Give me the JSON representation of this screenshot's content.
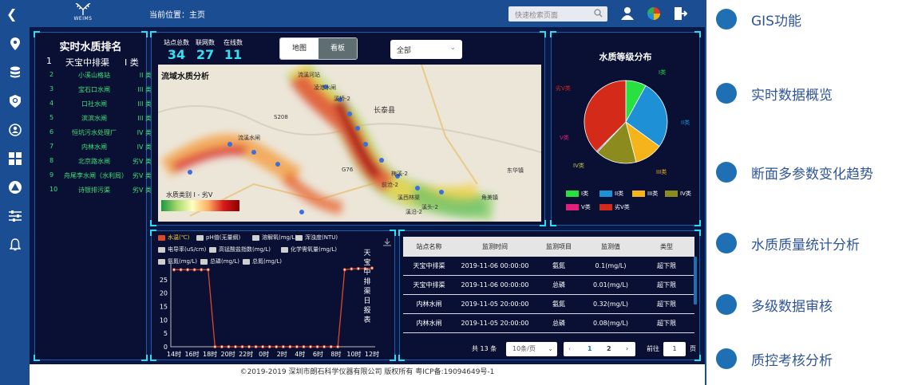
{
  "header": {
    "breadcrumb": "当前位置：主页",
    "logo_text": "WEIMS",
    "search_placeholder": "快速检索页面"
  },
  "ranking": {
    "title": "实时水质排名",
    "top": {
      "rank": "1",
      "name": "天宝中排渠",
      "class": "I 类"
    },
    "rows": [
      {
        "rank": "2",
        "name": "小溪山格站",
        "class": "II 类"
      },
      {
        "rank": "3",
        "name": "宝石口水闸",
        "class": "III 类"
      },
      {
        "rank": "4",
        "name": "口社水闸",
        "class": "III 类"
      },
      {
        "rank": "5",
        "name": "滨滨水闸",
        "class": "III 类"
      },
      {
        "rank": "6",
        "name": "恒坑污水处理厂",
        "class": "IV 类"
      },
      {
        "rank": "7",
        "name": "内林水闸",
        "class": "IV 类"
      },
      {
        "rank": "8",
        "name": "北京路水闸",
        "class": "劣V 类"
      },
      {
        "rank": "9",
        "name": "舟尾李水闸（水利局）",
        "class": "劣V 类"
      },
      {
        "rank": "10",
        "name": "诗银排污渠",
        "class": "劣V 类"
      }
    ]
  },
  "overview": {
    "stats": [
      {
        "label": "站点总数",
        "value": "34"
      },
      {
        "label": "联网数",
        "value": "27"
      },
      {
        "label": "在线数",
        "value": "11"
      }
    ],
    "tabs": [
      "地图",
      "看板"
    ],
    "filter_value": "全部",
    "map_title": "流域水质分析",
    "legend_label": "水质类别 I - 劣V",
    "map_labels": [
      "流溪河站",
      "凌港水闸",
      "溪桥-2",
      "长泰县",
      "S208",
      "流溪水闸",
      "东华镇",
      "G76",
      "梅溪-2",
      "前沧-2",
      "溪西林渠",
      "角美镇",
      "溪沿-2",
      "溪头-2"
    ]
  },
  "pie": {
    "title": "水质等级分布",
    "legend": [
      {
        "name": "I类",
        "color": "#28e040"
      },
      {
        "name": "II类",
        "color": "#1e90d6"
      },
      {
        "name": "III类",
        "color": "#f4b41a"
      },
      {
        "name": "IV类",
        "color": "#8c8c1e"
      },
      {
        "name": "V类",
        "color": "#e0207a"
      },
      {
        "name": "劣V类",
        "color": "#d42a1a"
      }
    ],
    "slices": [
      {
        "name": "I类",
        "value": 8
      },
      {
        "name": "II类",
        "value": 27
      },
      {
        "name": "III类",
        "value": 11
      },
      {
        "name": "IV类",
        "value": 16
      },
      {
        "name": "V类",
        "value": 0.5
      },
      {
        "name": "劣V类",
        "value": 37.5
      }
    ]
  },
  "trend": {
    "legend": [
      "水温(℃)",
      "pH值(无量纲)",
      "溶解氧(mg/L)",
      "浑浊度(NTU)",
      "电导率(uS/cm)",
      "高锰酸盐指数(mg/L)",
      "化学需氧量(mg/L)",
      "氨氮(mg/L)",
      "总磷(mg/L)",
      "总氮(mg/L)"
    ],
    "side_title": "天宝中排渠日报表"
  },
  "chart_data": {
    "type": "line",
    "x": [
      "14时",
      "16时",
      "18时",
      "20时",
      "22时",
      "0时",
      "2时",
      "4时",
      "6时",
      "8时",
      "10时",
      "12时"
    ],
    "series": [
      {
        "name": "水温(℃)",
        "values": [
          28.7,
          28.7,
          28.7,
          28.7,
          28.7,
          28.7,
          0,
          0,
          0,
          0,
          0,
          0,
          0,
          0,
          0,
          0,
          0,
          0,
          0,
          0,
          0,
          0,
          0,
          0,
          0,
          28.7,
          29,
          29.1,
          29.1,
          29.3
        ]
      }
    ],
    "ylim": [
      0,
      30
    ],
    "yticks": [
      "0",
      "5",
      "10",
      "15",
      "20",
      "25"
    ],
    "color": "#d84a2a"
  },
  "table": {
    "headers": [
      "站点名称",
      "监测时间",
      "监测项目",
      "监测值",
      "类型"
    ],
    "rows": [
      [
        "天宝中排渠",
        "2019-11-06 00:00:00",
        "氨氮",
        "0.1(mg/L)",
        "超下限"
      ],
      [
        "天宝中排渠",
        "2019-11-06 00:00:00",
        "总磷",
        "0.01(mg/L)",
        "超下限"
      ],
      [
        "内林水闸",
        "2019-11-05 20:00:00",
        "氨氮",
        "0.32(mg/L)",
        "超下限"
      ],
      [
        "内林水闸",
        "2019-11-05 20:00:00",
        "总磷",
        "0.08(mg/L)",
        "超下限"
      ]
    ],
    "pager": {
      "total": "共 13 条",
      "page_size": "10条/页",
      "pages": [
        "1",
        "2"
      ],
      "goto_label": "前往",
      "goto_value": "1",
      "page_suffix": "页"
    }
  },
  "footer": "©2019-2019 深圳市朗石科学仪器有限公司 版权所有 粤ICP备:19094649号-1",
  "features": [
    "GIS功能",
    "实时数据概览",
    "断面多参数变化趋势",
    "水质质量统计分析",
    "多级数据审核",
    "质控考核分析"
  ]
}
